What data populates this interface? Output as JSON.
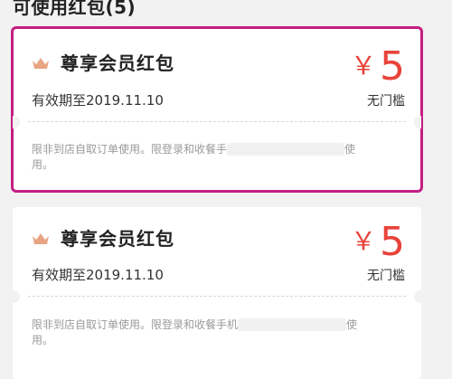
{
  "section_title": "可使用红包(5)",
  "coupons": [
    {
      "crown_icon": "crown-icon",
      "title": "尊享会员红包",
      "validity": "有效期至2019.11.10",
      "currency": "￥",
      "amount": "5",
      "threshold": "无门槛",
      "rule_prefix": "限非到店自取订单使用。限登录和收餐手",
      "rule_suffix": "使",
      "rule_line2": "用。",
      "selected": true
    },
    {
      "crown_icon": "crown-icon",
      "title": "尊享会员红包",
      "validity": "有效期至2019.11.10",
      "currency": "￥",
      "amount": "5",
      "threshold": "无门槛",
      "rule_prefix": "限非到店自取订单使用。限登录和收餐手机",
      "rule_suffix": "使",
      "rule_line2": "用。",
      "selected": false
    }
  ],
  "colors": {
    "price": "#e8433a",
    "highlight": "#c41e82",
    "crown": "#e8a584"
  }
}
